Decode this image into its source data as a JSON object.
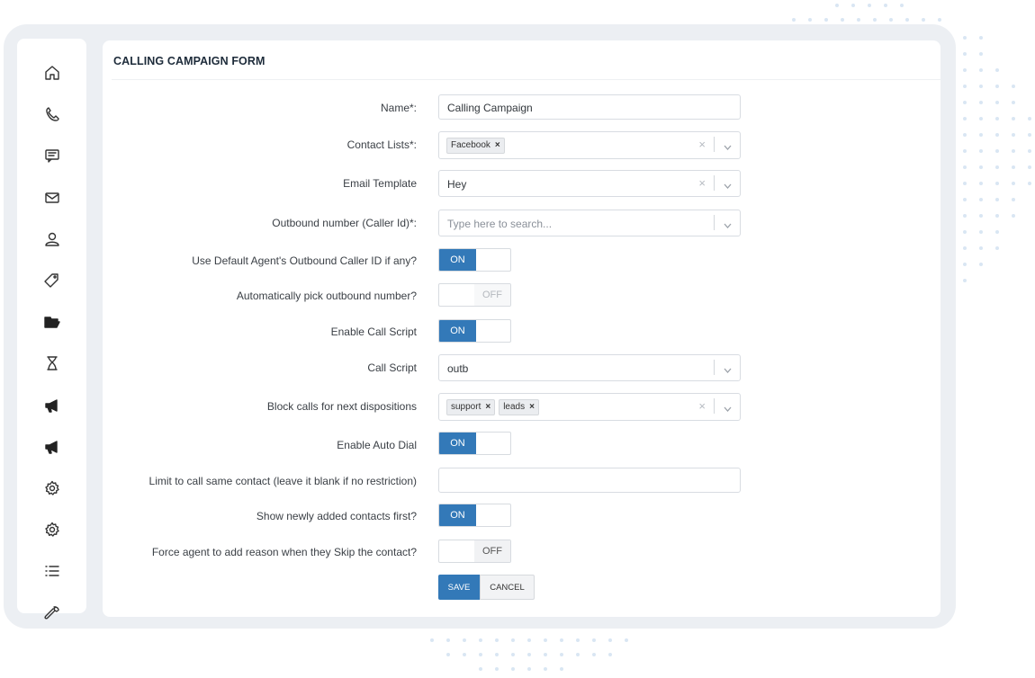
{
  "form": {
    "title": "CALLING CAMPAIGN FORM",
    "name_label": "Name*:",
    "name_value": "Calling Campaign",
    "contact_lists_label": "Contact Lists*:",
    "contact_lists_tags": [
      "Facebook"
    ],
    "email_template_label": "Email Template",
    "email_template_value": "Hey",
    "outbound_number_label": "Outbound number (Caller Id)*:",
    "outbound_number_placeholder": "Type here to search...",
    "default_agent_label": "Use Default Agent's Outbound Caller ID if any?",
    "default_agent_toggle": "ON",
    "auto_pick_label": "Automatically pick outbound number?",
    "auto_pick_toggle": "OFF",
    "enable_script_label": "Enable Call Script",
    "enable_script_toggle": "ON",
    "call_script_label": "Call Script",
    "call_script_value": "outb",
    "block_calls_label": "Block calls for next dispositions",
    "block_calls_tags": [
      "support",
      "leads"
    ],
    "auto_dial_label": "Enable Auto Dial",
    "auto_dial_toggle": "ON",
    "limit_label": "Limit to call same contact (leave it blank if no restriction)",
    "limit_value": "",
    "newly_added_label": "Show newly added contacts first?",
    "newly_added_toggle": "ON",
    "force_reason_label": "Force agent to add reason when they Skip the contact?",
    "force_reason_toggle": "OFF",
    "save_label": "SAVE",
    "cancel_label": "CANCEL"
  },
  "sidebar": {
    "icons": [
      "home-icon",
      "phone-icon",
      "chat-icon",
      "mail-icon",
      "user-icon",
      "tag-icon",
      "folder-icon",
      "hourglass-icon",
      "megaphone-icon",
      "megaphone-icon",
      "gear-icon",
      "gear-icon",
      "list-icon",
      "wrench-icon"
    ]
  },
  "colors": {
    "accent": "#3379b8",
    "frame": "#eceff3"
  }
}
